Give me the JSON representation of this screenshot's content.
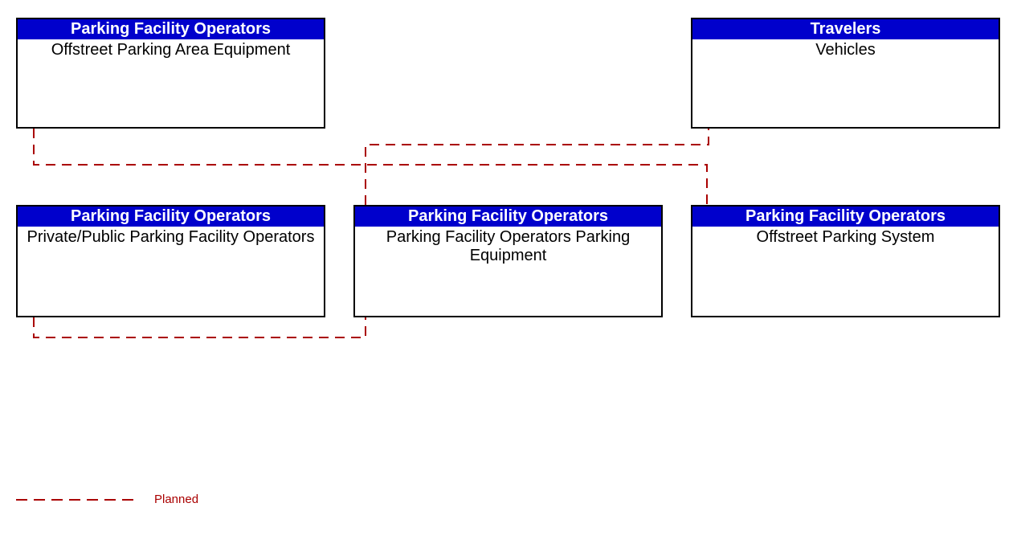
{
  "boxes": {
    "b1": {
      "header": "Parking Facility Operators",
      "body": "Offstreet Parking Area Equipment"
    },
    "b2": {
      "header": "Travelers",
      "body": "Vehicles"
    },
    "b3": {
      "header": "Parking Facility Operators",
      "body": "Private/Public Parking Facility Operators"
    },
    "b4": {
      "header": "Parking Facility Operators",
      "body": "Parking Facility Operators Parking Equipment"
    },
    "b5": {
      "header": "Parking Facility Operators",
      "body": "Offstreet Parking System"
    }
  },
  "legend": {
    "label": "Planned"
  },
  "colors": {
    "headerBg": "#0000cc",
    "line": "#aa0000"
  }
}
